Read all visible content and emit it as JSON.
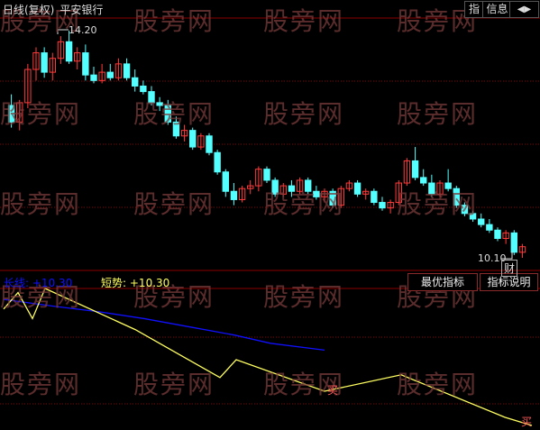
{
  "header": {
    "chart_title": "日线(复权)",
    "stock_name": "平安银行",
    "btn_indicator": "指",
    "btn_info": "信息",
    "btn_arrow": "◀▶"
  },
  "watermark": "股旁网",
  "price_chart": {
    "high_label": "14.20",
    "low_label": "10.10",
    "finance_badge": "财"
  },
  "indicator": {
    "line1_label": "长线",
    "line1_value": "+10.30",
    "line2_label": "短势:",
    "line2_value": "+10.30",
    "buy_label": "买",
    "btn_best": "最优指标",
    "btn_explain": "指标说明"
  },
  "colors": {
    "up": "#ff3b3b",
    "down": "#54ffff",
    "grid": "#8b0000",
    "long_line": "#1010ff",
    "short_line": "#ffff60"
  },
  "chart_data": {
    "type": "candlestick",
    "range": [
      10.1,
      14.2
    ],
    "candles": [
      [
        12.85,
        13.05,
        12.45,
        12.55
      ],
      [
        12.55,
        12.95,
        12.4,
        12.9
      ],
      [
        12.9,
        13.6,
        12.8,
        13.5
      ],
      [
        13.5,
        13.9,
        13.3,
        13.8
      ],
      [
        13.8,
        13.9,
        13.35,
        13.45
      ],
      [
        13.45,
        13.8,
        13.3,
        13.7
      ],
      [
        13.7,
        14.1,
        13.6,
        14.0
      ],
      [
        14.0,
        14.2,
        13.6,
        13.65
      ],
      [
        13.65,
        13.9,
        13.5,
        13.8
      ],
      [
        13.8,
        13.95,
        13.3,
        13.4
      ],
      [
        13.4,
        13.55,
        13.25,
        13.3
      ],
      [
        13.3,
        13.6,
        13.25,
        13.45
      ],
      [
        13.45,
        13.6,
        13.3,
        13.35
      ],
      [
        13.35,
        13.7,
        13.3,
        13.6
      ],
      [
        13.6,
        13.7,
        13.3,
        13.35
      ],
      [
        13.35,
        13.5,
        13.1,
        13.2
      ],
      [
        13.2,
        13.3,
        13.05,
        13.1
      ],
      [
        13.1,
        13.2,
        12.85,
        12.9
      ],
      [
        12.9,
        13.0,
        12.75,
        12.85
      ],
      [
        12.85,
        12.95,
        12.5,
        12.55
      ],
      [
        12.55,
        12.65,
        12.25,
        12.3
      ],
      [
        12.3,
        12.5,
        12.2,
        12.4
      ],
      [
        12.4,
        12.45,
        12.05,
        12.1
      ],
      [
        12.1,
        12.35,
        12.05,
        12.3
      ],
      [
        12.3,
        12.35,
        11.95,
        12.0
      ],
      [
        12.0,
        12.05,
        11.6,
        11.65
      ],
      [
        11.65,
        11.7,
        11.2,
        11.3
      ],
      [
        11.3,
        11.45,
        11.05,
        11.15
      ],
      [
        11.15,
        11.4,
        11.1,
        11.35
      ],
      [
        11.35,
        11.5,
        11.25,
        11.4
      ],
      [
        11.4,
        11.75,
        11.3,
        11.7
      ],
      [
        11.7,
        11.75,
        11.45,
        11.5
      ],
      [
        11.5,
        11.55,
        11.2,
        11.25
      ],
      [
        11.25,
        11.45,
        11.2,
        11.4
      ],
      [
        11.4,
        11.5,
        11.2,
        11.3
      ],
      [
        11.3,
        11.55,
        11.25,
        11.5
      ],
      [
        11.5,
        11.55,
        11.25,
        11.3
      ],
      [
        11.3,
        11.4,
        11.15,
        11.2
      ],
      [
        11.2,
        11.35,
        11.1,
        11.3
      ],
      [
        11.3,
        11.35,
        11.0,
        11.05
      ],
      [
        11.05,
        11.4,
        11.0,
        11.35
      ],
      [
        11.35,
        11.5,
        11.3,
        11.45
      ],
      [
        11.45,
        11.5,
        11.2,
        11.25
      ],
      [
        11.25,
        11.35,
        11.15,
        11.3
      ],
      [
        11.3,
        11.35,
        11.05,
        11.1
      ],
      [
        11.1,
        11.2,
        10.95,
        11.0
      ],
      [
        11.0,
        11.15,
        10.9,
        11.1
      ],
      [
        11.1,
        11.5,
        11.05,
        11.45
      ],
      [
        11.45,
        11.9,
        11.4,
        11.85
      ],
      [
        11.85,
        12.1,
        11.5,
        11.55
      ],
      [
        11.55,
        11.7,
        11.4,
        11.45
      ],
      [
        11.45,
        11.6,
        11.2,
        11.25
      ],
      [
        11.25,
        11.5,
        11.2,
        11.45
      ],
      [
        11.45,
        11.7,
        11.3,
        11.35
      ],
      [
        11.35,
        11.4,
        11.0,
        11.05
      ],
      [
        11.05,
        11.1,
        10.85,
        10.9
      ],
      [
        10.9,
        10.95,
        10.75,
        10.8
      ],
      [
        10.8,
        10.9,
        10.65,
        10.7
      ],
      [
        10.7,
        10.8,
        10.55,
        10.6
      ],
      [
        10.6,
        10.65,
        10.4,
        10.45
      ],
      [
        10.45,
        10.6,
        10.35,
        10.55
      ],
      [
        10.55,
        10.6,
        10.15,
        10.2
      ],
      [
        10.2,
        10.35,
        10.1,
        10.3
      ]
    ],
    "indicator_range": [
      0,
      1
    ],
    "long_line": [
      0.92,
      0.87,
      0.83,
      0.78,
      0.72,
      0.66,
      0.6,
      0.55,
      0.5,
      0.45,
      0.4
    ],
    "short_line": [
      0.85,
      0.97,
      0.78,
      1.0,
      0.7,
      0.35,
      0.48,
      0.25,
      0.37,
      0.06,
      0.0
    ]
  }
}
